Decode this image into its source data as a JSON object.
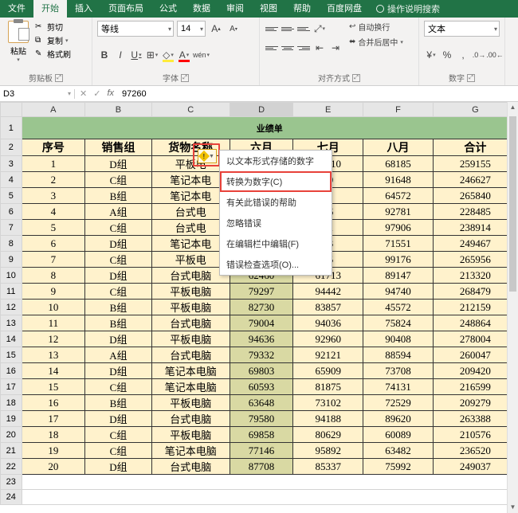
{
  "tabs": {
    "items": [
      "文件",
      "开始",
      "插入",
      "页面布局",
      "公式",
      "数据",
      "审阅",
      "视图",
      "帮助",
      "百度网盘"
    ],
    "active": 1,
    "search": "操作说明搜索"
  },
  "ribbon": {
    "clipboard": {
      "paste": "粘贴",
      "cut": "剪切",
      "copy": "复制",
      "format_painter": "格式刷",
      "label": "剪贴板"
    },
    "font": {
      "name": "等线",
      "size": "14",
      "label": "字体",
      "B": "B",
      "I": "I",
      "U": "U",
      "A": "A",
      "wen": "wén"
    },
    "align": {
      "label": "对齐方式",
      "wrap": "自动换行",
      "merge": "合并后居中"
    },
    "number": {
      "format": "文本",
      "label": "数字"
    }
  },
  "fx": {
    "cell": "D3",
    "value": "97260"
  },
  "cols": [
    "A",
    "B",
    "C",
    "D",
    "E",
    "F",
    "G"
  ],
  "title": "业绩单",
  "headers": [
    "序号",
    "销售组",
    "货物名称",
    "六月",
    "七月",
    "八月",
    "合计"
  ],
  "rows": [
    [
      "1",
      "D组",
      "平板电",
      "97260",
      "93710",
      "68185",
      "259155"
    ],
    [
      "2",
      "C组",
      "笔记本电",
      "",
      "90",
      "91648",
      "246627"
    ],
    [
      "3",
      "B组",
      "笔记本电",
      "",
      "2",
      "64572",
      "265840"
    ],
    [
      "4",
      "A组",
      "台式电",
      "",
      "36",
      "92781",
      "228485"
    ],
    [
      "5",
      "C组",
      "台式电",
      "",
      "31",
      "97906",
      "238914"
    ],
    [
      "6",
      "D组",
      "笔记本电",
      "",
      "63",
      "71551",
      "249467"
    ],
    [
      "7",
      "C组",
      "平板电",
      "",
      "25",
      "99176",
      "265956"
    ],
    [
      "8",
      "D组",
      "台式电脑",
      "62460",
      "61713",
      "89147",
      "213320"
    ],
    [
      "9",
      "C组",
      "平板电脑",
      "79297",
      "94442",
      "94740",
      "268479"
    ],
    [
      "10",
      "B组",
      "平板电脑",
      "82730",
      "83857",
      "45572",
      "212159"
    ],
    [
      "11",
      "B组",
      "台式电脑",
      "79004",
      "94036",
      "75824",
      "248864"
    ],
    [
      "12",
      "D组",
      "平板电脑",
      "94636",
      "92960",
      "90408",
      "278004"
    ],
    [
      "13",
      "A组",
      "台式电脑",
      "79332",
      "92121",
      "88594",
      "260047"
    ],
    [
      "14",
      "D组",
      "笔记本电脑",
      "69803",
      "65909",
      "73708",
      "209420"
    ],
    [
      "15",
      "C组",
      "笔记本电脑",
      "60593",
      "81875",
      "74131",
      "216599"
    ],
    [
      "16",
      "B组",
      "平板电脑",
      "63648",
      "73102",
      "72529",
      "209279"
    ],
    [
      "17",
      "D组",
      "台式电脑",
      "79580",
      "94188",
      "89620",
      "263388"
    ],
    [
      "18",
      "C组",
      "平板电脑",
      "69858",
      "80629",
      "60089",
      "210576"
    ],
    [
      "19",
      "C组",
      "笔记本电脑",
      "77146",
      "95892",
      "63482",
      "236520"
    ],
    [
      "20",
      "D组",
      "台式电脑",
      "87708",
      "85337",
      "75992",
      "249037"
    ]
  ],
  "extra_rows": [
    "23",
    "24"
  ],
  "ctx": {
    "items": [
      "以文本形式存储的数字",
      "转换为数字(C)",
      "有关此错误的帮助",
      "忽略错误",
      "在编辑栏中编辑(F)",
      "错误检查选项(O)..."
    ],
    "highlight": 1
  },
  "colors": {
    "brand": "#217346",
    "ribbon_bg": "#f3f2f1",
    "header_fill": "#9ac58f",
    "data_fill": "#fff2cc",
    "sel_fill": "#d9d9a3",
    "highlight": "#e8423a"
  }
}
